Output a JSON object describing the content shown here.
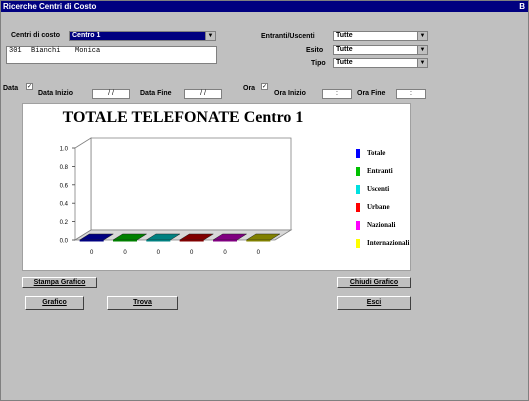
{
  "window": {
    "title": "Ricerche Centri di Costo",
    "corner": "B"
  },
  "centri": {
    "label": "Centri di costo",
    "selected": "Centro 1"
  },
  "listbox": {
    "code": "301",
    "surname": "Bianchi",
    "name": "Monica"
  },
  "filters": {
    "entranti": {
      "label": "Entranti/Uscenti",
      "value": "Tutte"
    },
    "esito": {
      "label": "Esito",
      "value": "Tutte"
    },
    "tipo": {
      "label": "Tipo",
      "value": "Tutte"
    }
  },
  "data_row": {
    "data_label": "Data",
    "data_checked": true,
    "data_inizio_label": "Data Inizio",
    "data_inizio_value": "/ /",
    "data_fine_label": "Data Fine",
    "data_fine_value": "/ /",
    "ora_label": "Ora",
    "ora_checked": true,
    "ora_inizio_label": "Ora Inizio",
    "ora_inizio_value": ":",
    "ora_fine_label": "Ora Fine",
    "ora_fine_value": ":"
  },
  "chart_data": {
    "type": "bar",
    "title": "TOTALE TELEFONATE Centro 1",
    "ylim": [
      0,
      1
    ],
    "yticks": [
      "1.0",
      "0.8",
      "0.6",
      "0.4",
      "0.2",
      "0.0"
    ],
    "categories": [
      "0",
      "0",
      "0",
      "0",
      "0",
      "0"
    ],
    "values": [
      0,
      0,
      0,
      0,
      0,
      0
    ],
    "series": [
      {
        "name": "Totale",
        "color": "#0000ff"
      },
      {
        "name": "Entranti",
        "color": "#00c000"
      },
      {
        "name": "Uscenti",
        "color": "#00e0e0"
      },
      {
        "name": "Urbane",
        "color": "#ff0000"
      },
      {
        "name": "Nazionali",
        "color": "#ff00ff"
      },
      {
        "name": "Internazionali",
        "color": "#ffff00"
      }
    ],
    "bar_colors": [
      "#000080",
      "#008000",
      "#008080",
      "#800000",
      "#800080",
      "#808000"
    ],
    "legend_position": "right",
    "grid": false
  },
  "buttons": {
    "stampa": "Stampa Grafico",
    "chiudi": "Chiudi Grafico",
    "grafico": "Grafico",
    "trova": "Trova",
    "esci": "Esci"
  }
}
